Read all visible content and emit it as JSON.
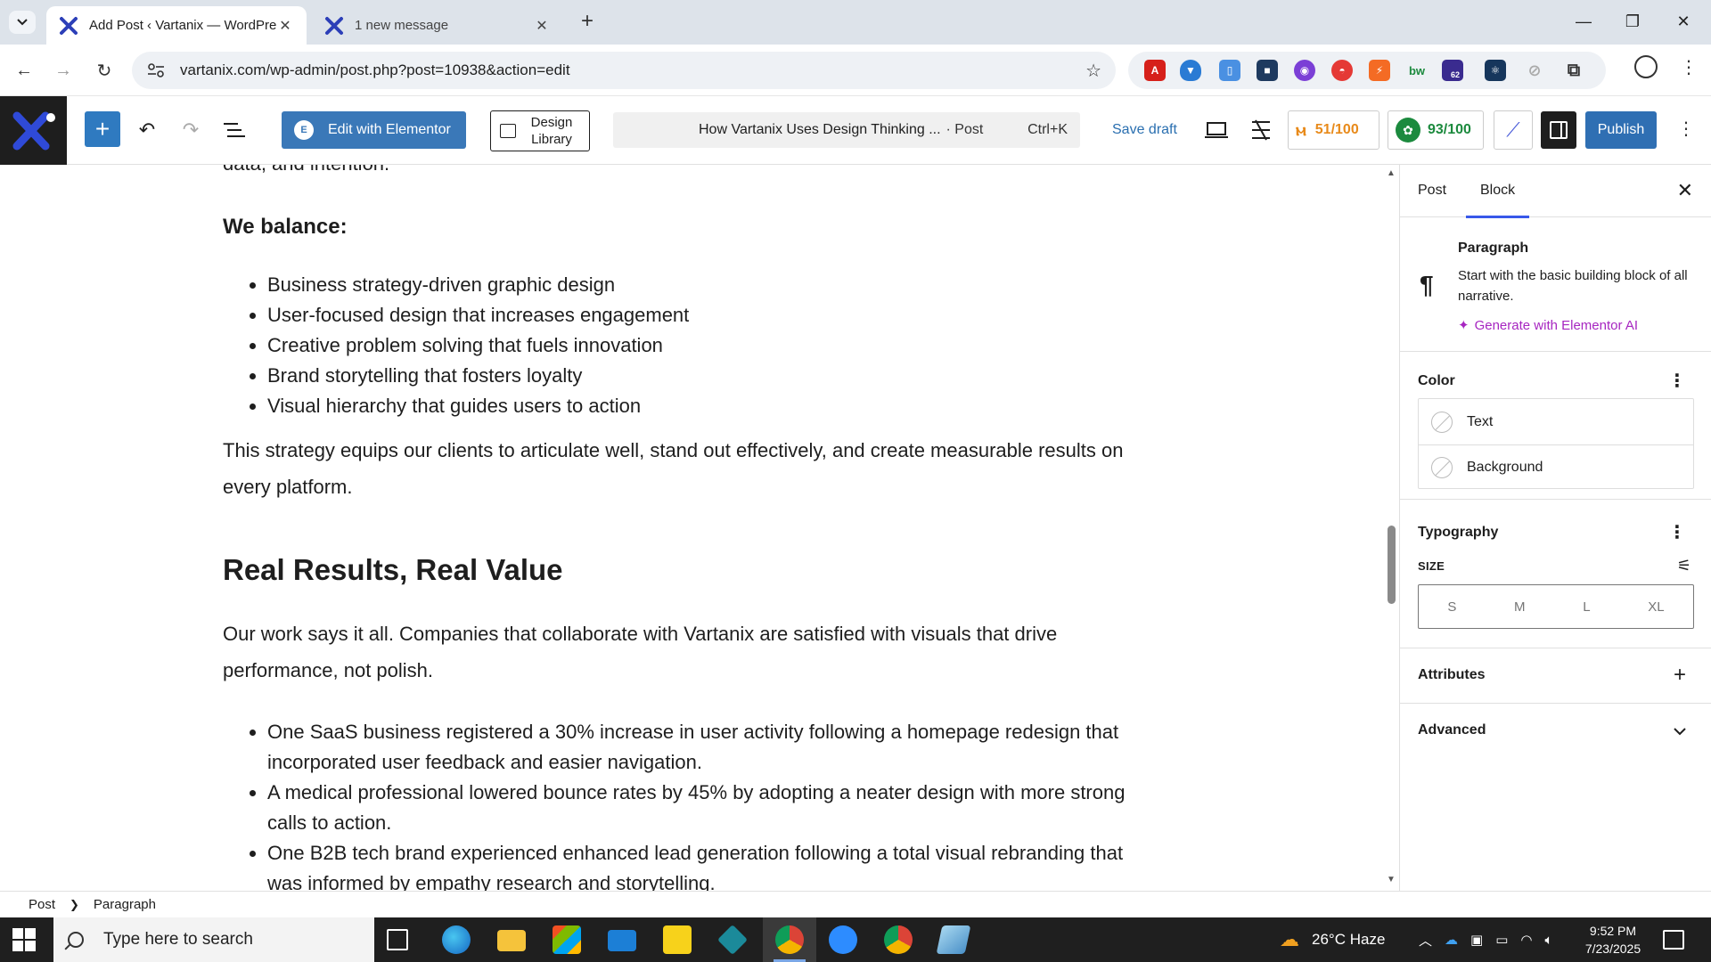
{
  "browser": {
    "tabs": [
      {
        "title": "Add Post ‹ Vartanix — WordPre",
        "active": true
      },
      {
        "title": "1 new message",
        "active": false
      }
    ],
    "url": "vartanix.com/wp-admin/post.php?post=10938&action=edit",
    "extension_badge": "62"
  },
  "editor_header": {
    "elementor_label": "Edit with Elementor",
    "design_library_label": "Design Library",
    "command_title": "How Vartanix Uses Design Thinking ...",
    "command_type": "· Post",
    "command_shortcut": "Ctrl+K",
    "save_draft_label": "Save draft",
    "seo_score": "51/100",
    "readability_score": "93/100",
    "publish_label": "Publish"
  },
  "content": {
    "top_fragment": "data, and intention.",
    "balance_heading": "We balance:",
    "balance_items": [
      "Business strategy-driven graphic design",
      "User-focused design that increases engagement",
      "Creative problem solving that fuels innovation",
      "Brand storytelling that fosters loyalty",
      "Visual hierarchy that guides users to action"
    ],
    "strategy_paragraph": "This strategy equips our clients to articulate well, stand out effectively, and create measurable results on every platform.",
    "results_heading": "Real Results, Real Value",
    "results_paragraph": "Our work says it all. Companies that collaborate with Vartanix are satisfied with visuals that drive performance, not polish.",
    "results_items": [
      "One SaaS business registered a 30% increase in user activity following a homepage redesign that incorporated user feedback and easier navigation.",
      "A medical professional lowered bounce rates by 45% by adopting a neater design with more strong calls to action.",
      "One B2B tech brand experienced enhanced lead generation following a total visual rebranding that was informed by empathy research and storytelling."
    ]
  },
  "sidebar": {
    "tab_post": "Post",
    "tab_block": "Block",
    "block_name": "Paragraph",
    "block_description": "Start with the basic building block of all narrative.",
    "generate_ai": "Generate with Elementor AI",
    "color_title": "Color",
    "color_text": "Text",
    "color_background": "Background",
    "typography_title": "Typography",
    "size_label": "SIZE",
    "sizes": [
      "S",
      "M",
      "L",
      "XL"
    ],
    "attributes_title": "Attributes",
    "advanced_title": "Advanced"
  },
  "breadcrumb": {
    "root": "Post",
    "current": "Paragraph"
  },
  "taskbar": {
    "search_placeholder": "Type here to search",
    "weather": "26°C Haze",
    "time": "9:52 PM",
    "date": "7/23/2025"
  },
  "colors": {
    "accent_blue": "#3858e9",
    "elementor_blue": "#3a78b8",
    "publish_blue": "#2f6fb3",
    "seo_orange": "#e88a1a",
    "readability_green": "#1c8a3e",
    "ai_purple": "#a726c1"
  }
}
